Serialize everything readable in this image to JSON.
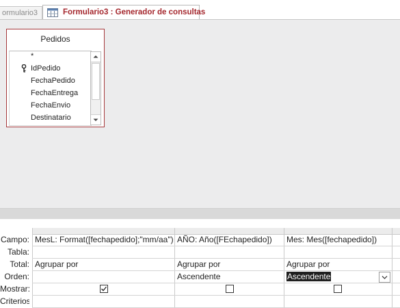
{
  "tabs": [
    {
      "label": "ormulario3",
      "active": false
    },
    {
      "label": "Formulario3 : Generador de consultas",
      "active": true
    }
  ],
  "table": {
    "title": "Pedidos",
    "fields": [
      "*",
      "IdPedido",
      "FechaPedido",
      "FechaEntrega",
      "FechaEnvio",
      "Destinatario"
    ],
    "primary_key": "IdPedido"
  },
  "grid": {
    "row_labels": [
      "Campo:",
      "Tabla:",
      "Total:",
      "Orden:",
      "Mostrar:",
      "Criterios:"
    ],
    "columns": [
      {
        "campo": "MesL: Format([fechapedido];\"mm/aa\")",
        "tabla": "",
        "total": "Agrupar por",
        "orden": "",
        "mostrar": true,
        "criterios": ""
      },
      {
        "campo": "AÑO: Año([FEchapedido])",
        "tabla": "",
        "total": "Agrupar por",
        "orden": "Ascendente",
        "mostrar": false,
        "criterios": ""
      },
      {
        "campo": "Mes: Mes([fechapedido])",
        "tabla": "",
        "total": "Agrupar por",
        "orden": "Ascendente",
        "mostrar": false,
        "criterios": ""
      }
    ]
  },
  "colors": {
    "accent": "#a4262c",
    "table_border": "#a4373a",
    "surface": "#ececed"
  }
}
